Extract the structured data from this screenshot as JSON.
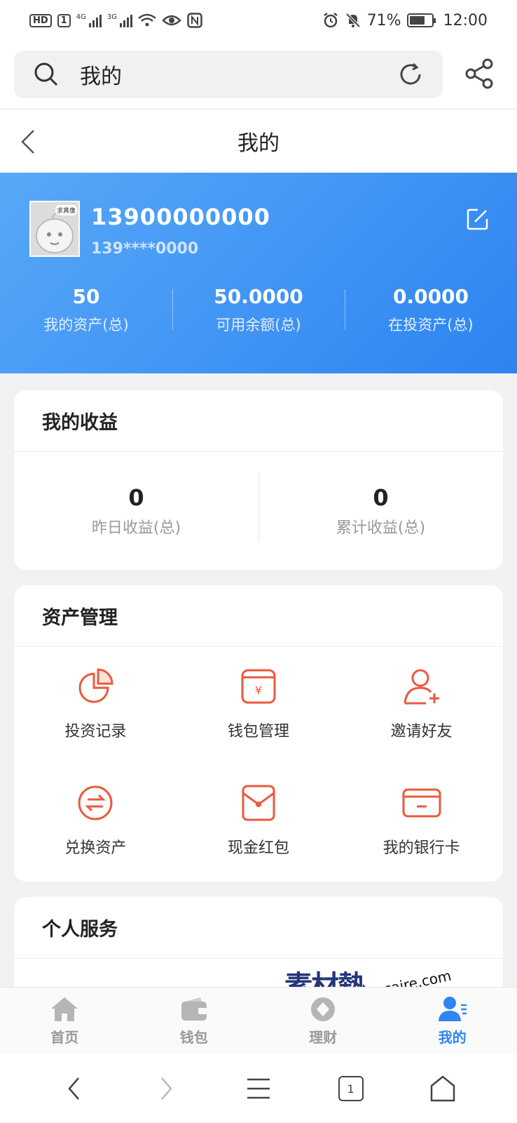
{
  "status_bar": {
    "left_chip1": "HD",
    "left_chip2": "1",
    "net1": "4G",
    "net2": "3G",
    "battery": "71%",
    "battery_level": 0.71,
    "time": "12:00",
    "icons": [
      "hd-icon",
      "signal-icon",
      "wifi-icon",
      "eye-icon",
      "nfc-icon",
      "alarm-icon",
      "mute-icon",
      "battery-icon"
    ]
  },
  "browser": {
    "address_text": "我的",
    "icons": [
      "search-icon",
      "refresh-icon",
      "share-icon"
    ]
  },
  "header": {
    "title": "我的"
  },
  "profile": {
    "avatar_tag": "求真像",
    "phone": "13900000000",
    "phone_masked": "139****0000",
    "stats": [
      {
        "value": "50",
        "label": "我的资产(总)"
      },
      {
        "value": "50.0000",
        "label": "可用余额(总)"
      },
      {
        "value": "0.0000",
        "label": "在投资产(总)"
      }
    ]
  },
  "earnings": {
    "title": "我的收益",
    "items": [
      {
        "value": "0",
        "label": "昨日收益(总)"
      },
      {
        "value": "0",
        "label": "累计收益(总)"
      }
    ]
  },
  "assets": {
    "title": "资产管理",
    "items": [
      {
        "label": "投资记录",
        "icon": "pie-chart-icon"
      },
      {
        "label": "钱包管理",
        "icon": "wallet-yen-icon"
      },
      {
        "label": "邀请好友",
        "icon": "add-user-icon"
      },
      {
        "label": "兑换资产",
        "icon": "exchange-icon"
      },
      {
        "label": "现金红包",
        "icon": "red-envelope-icon"
      },
      {
        "label": "我的银行卡",
        "icon": "bank-card-icon"
      }
    ]
  },
  "services": {
    "title": "个人服务"
  },
  "tabbar": {
    "items": [
      {
        "label": "首页",
        "icon": "home-icon"
      },
      {
        "label": "钱包",
        "icon": "wallet-icon"
      },
      {
        "label": "理财",
        "icon": "finance-icon"
      },
      {
        "label": "我的",
        "icon": "user-icon"
      }
    ],
    "active": "我的"
  },
  "watermark": {
    "logo": "素材熱",
    "domain": "sucaire.com"
  },
  "nav": {
    "tab_count": "1"
  },
  "colors": {
    "brand_blue": "#2f86f0",
    "accent_red": "#ea5a3d"
  }
}
